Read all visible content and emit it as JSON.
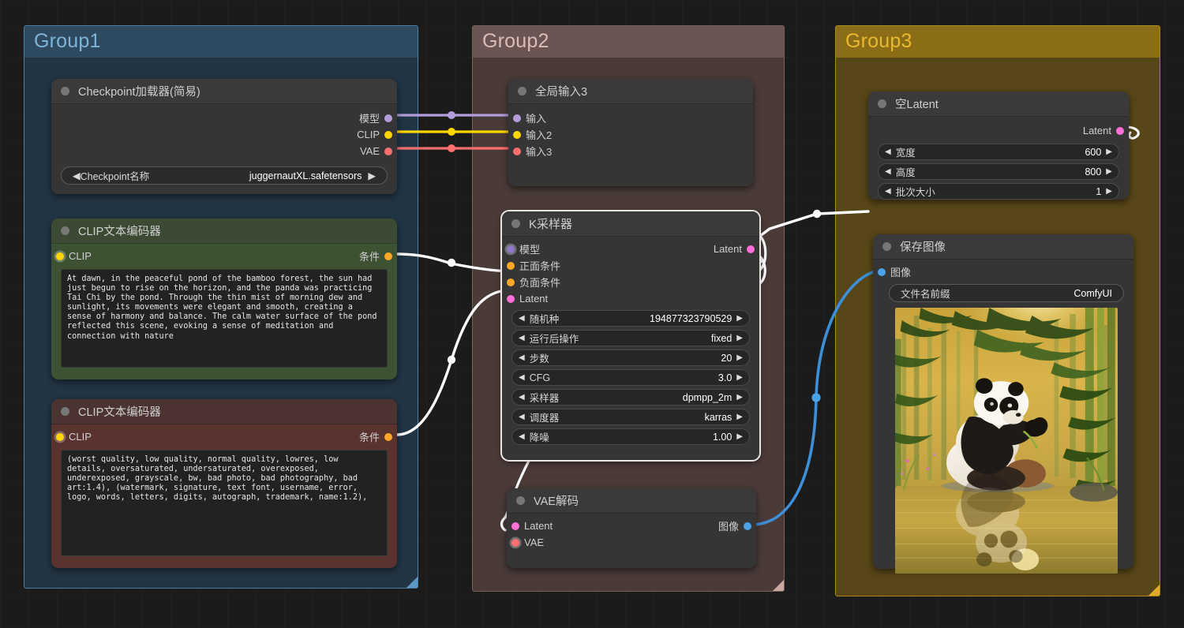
{
  "canvas": {
    "background": "#1b1b1b",
    "grid": "on"
  },
  "groups": [
    {
      "title": "Group1",
      "accent": "#5d97c4",
      "header_bg": "#2d4a61",
      "body_bg": "#223544"
    },
    {
      "title": "Group2",
      "accent": "#c9a8a4",
      "header_bg": "#6a5552",
      "body_bg": "#4a3b39"
    },
    {
      "title": "Group3",
      "accent": "#e0a92a",
      "header_bg": "#8a6d16",
      "body_bg": "#5c4a12"
    }
  ],
  "nodes": {
    "checkpoint_loader": {
      "title": "Checkpoint加载器(简易)",
      "outputs": [
        {
          "label": "模型",
          "color": "#b39ddb"
        },
        {
          "label": "CLIP",
          "color": "#ffd600"
        },
        {
          "label": "VAE",
          "color": "#ff6f6f"
        }
      ],
      "widget": {
        "name": "Checkpoint名称",
        "value": "juggernautXL.safetensors"
      }
    },
    "clip_positive": {
      "title": "CLIP文本编码器",
      "input": {
        "label": "CLIP",
        "color": "#ffd600"
      },
      "output": {
        "label": "条件",
        "color": "#ffa726"
      },
      "text": "At dawn, in the peaceful pond of the bamboo forest, the sun had just begun to rise on the horizon, and the panda was practicing Tai Chi by the pond. Through the thin mist of morning dew and sunlight, its movements were elegant and smooth, creating a sense of harmony and balance. The calm water surface of the pond reflected this scene, evoking a sense of meditation and connection with nature",
      "header_bg": "#3d4a33",
      "body_bg": "#3c5233"
    },
    "clip_negative": {
      "title": "CLIP文本编码器",
      "input": {
        "label": "CLIP",
        "color": "#ffd600"
      },
      "output": {
        "label": "条件",
        "color": "#ffa726"
      },
      "text": "(worst quality, low quality, normal quality, lowres, low details, oversaturated, undersaturated, overexposed, underexposed, grayscale, bw, bad photo, bad photography, bad art:1.4), (watermark, signature, text font, username, error, logo, words, letters, digits, autograph, trademark, name:1.2),",
      "header_bg": "#4a3330",
      "body_bg": "#5a332e"
    },
    "global_input": {
      "title": "全局输入3",
      "inputs": [
        {
          "label": "输入",
          "color": "#b39ddb"
        },
        {
          "label": "输入2",
          "color": "#ffd600"
        },
        {
          "label": "输入3",
          "color": "#ff6f6f"
        }
      ]
    },
    "ksampler": {
      "title": "K采样器",
      "selected": true,
      "inputs": [
        {
          "label": "模型",
          "color": "#b39ddb"
        },
        {
          "label": "正面条件",
          "color": "#ffa726"
        },
        {
          "label": "负面条件",
          "color": "#ffa726"
        },
        {
          "label": "Latent",
          "color": "#ff6fd8"
        }
      ],
      "outputs": [
        {
          "label": "Latent",
          "color": "#ff6fd8"
        }
      ],
      "widgets": [
        {
          "name": "随机种",
          "value": "194877323790529"
        },
        {
          "name": "运行后操作",
          "value": "fixed"
        },
        {
          "name": "步数",
          "value": "20"
        },
        {
          "name": "CFG",
          "value": "3.0"
        },
        {
          "name": "采样器",
          "value": "dpmpp_2m"
        },
        {
          "name": "调度器",
          "value": "karras"
        },
        {
          "name": "降噪",
          "value": "1.00"
        }
      ]
    },
    "vae_decode": {
      "title": "VAE解码",
      "inputs": [
        {
          "label": "Latent",
          "color": "#ff6fd8"
        },
        {
          "label": "VAE",
          "color": "#ff6f6f",
          "ring": true
        }
      ],
      "outputs": [
        {
          "label": "图像",
          "color": "#4aa3e8"
        }
      ]
    },
    "empty_latent": {
      "title": "空Latent",
      "outputs": [
        {
          "label": "Latent",
          "color": "#ff6fd8"
        }
      ],
      "widgets": [
        {
          "name": "宽度",
          "value": "600"
        },
        {
          "name": "高度",
          "value": "800"
        },
        {
          "name": "批次大小",
          "value": "1"
        }
      ]
    },
    "save_image": {
      "title": "保存图像",
      "inputs": [
        {
          "label": "图像",
          "color": "#4aa3e8"
        }
      ],
      "widget": {
        "name": "文件名前缀",
        "value": "ComfyUI"
      },
      "preview_alt": "panda meditating by a pond in a bamboo forest at sunrise"
    }
  },
  "link_colors": {
    "model": "#b39ddb",
    "clip": "#ffd600",
    "vae": "#ff6f6f",
    "conditioning": "#ffffff",
    "latent": "#ffffff",
    "image": "#4aa3e8"
  }
}
